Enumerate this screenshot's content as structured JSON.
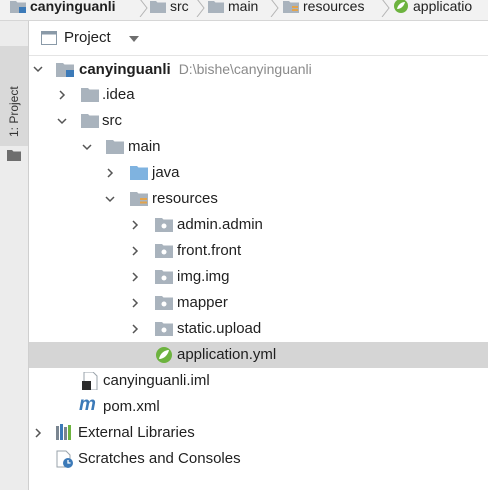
{
  "breadcrumb": {
    "items": [
      {
        "label": "canyinguanli",
        "icon": "module-folder-icon"
      },
      {
        "label": "src",
        "icon": "folder-icon"
      },
      {
        "label": "main",
        "icon": "folder-icon"
      },
      {
        "label": "resources",
        "icon": "resources-folder-icon"
      },
      {
        "label": "applicatio",
        "icon": "spring-leaf-icon"
      }
    ]
  },
  "tool_strip": {
    "tab_label": "1: Project"
  },
  "panel": {
    "title": "Project",
    "view_selector": "chevron-down-icon"
  },
  "tree": {
    "root": {
      "label": "canyinguanli",
      "path": "D:\\bishe\\canyinguanli"
    },
    "idea": "idea",
    "src": "src",
    "main": "main",
    "java": "java",
    "resources": "resources",
    "admin": "admin.admin",
    "front": "front.front",
    "img": "img.img",
    "mapper": "mapper",
    "static": "static.upload",
    "application": "application.yml",
    "iml": "canyinguanli.iml",
    "pom": "pom.xml",
    "external": "External Libraries",
    "scratches": "Scratches and Consoles"
  },
  "colors": {
    "folder": "#a9b3bd",
    "java_folder": "#7fb3e0",
    "spring": "#6db33f",
    "selected_row": "#d5d5d5",
    "maven": "#3c7ab8"
  }
}
